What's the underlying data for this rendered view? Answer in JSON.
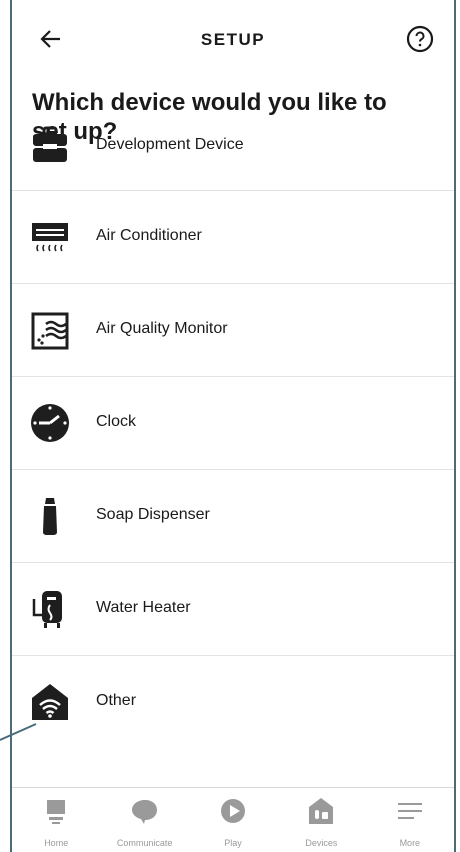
{
  "header": {
    "title": "SETUP"
  },
  "heading": "Which device would you like to set up?",
  "devices": [
    {
      "label": "Development Device",
      "icon": "toolbox-icon"
    },
    {
      "label": "Air Conditioner",
      "icon": "air-conditioner-icon"
    },
    {
      "label": "Air Quality Monitor",
      "icon": "air-quality-icon"
    },
    {
      "label": "Clock",
      "icon": "clock-icon"
    },
    {
      "label": "Soap Dispenser",
      "icon": "soap-dispenser-icon"
    },
    {
      "label": "Water Heater",
      "icon": "water-heater-icon"
    },
    {
      "label": "Other",
      "icon": "smart-home-icon"
    }
  ],
  "nav": [
    {
      "label": "Home",
      "icon": "home-icon"
    },
    {
      "label": "Communicate",
      "icon": "chat-icon"
    },
    {
      "label": "Play",
      "icon": "play-icon"
    },
    {
      "label": "Devices",
      "icon": "devices-icon"
    },
    {
      "label": "More",
      "icon": "menu-icon"
    }
  ],
  "colors": {
    "frame": "#4a6b7a",
    "icon": "#1e1e1e",
    "nav_icon": "#9a9a9a"
  }
}
